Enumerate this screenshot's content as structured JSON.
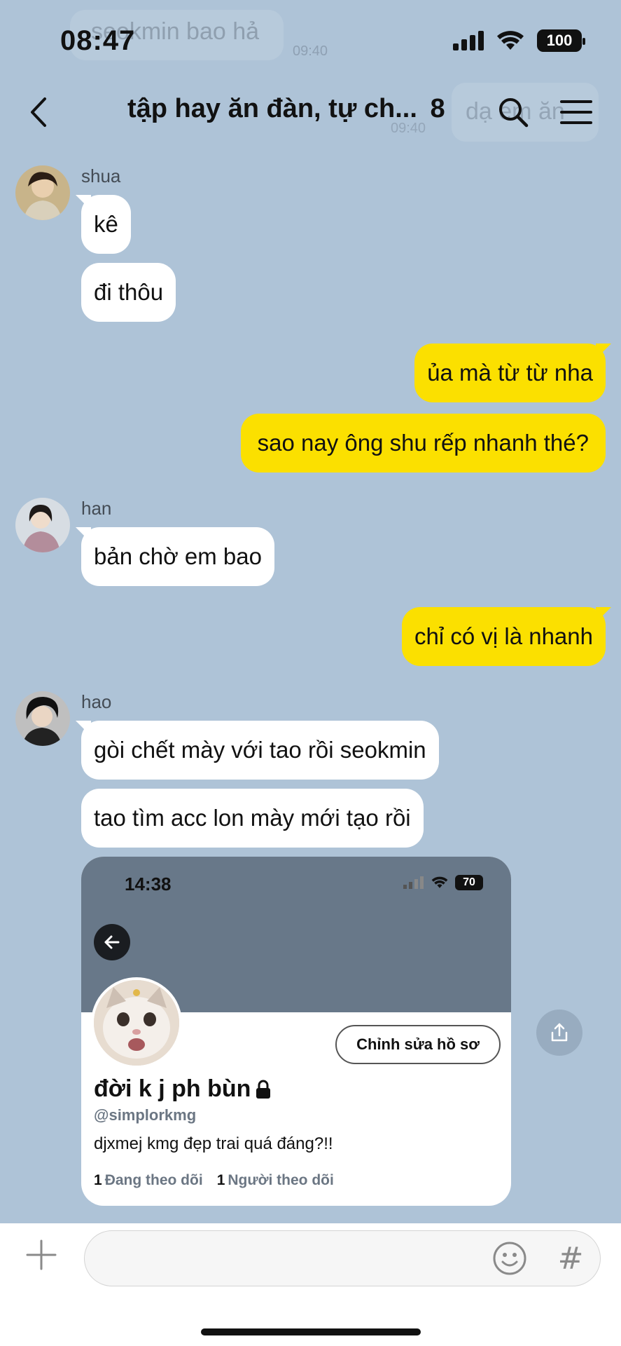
{
  "status_bar": {
    "time": "08:47",
    "battery": "100"
  },
  "background_ghost": {
    "message": "seokmin bao hả",
    "time": "09:40",
    "right_message": "dạ em ăn",
    "right_time": "09:40"
  },
  "header": {
    "title": "tập hay ăn đàn, tự ch...",
    "member_count": "8"
  },
  "messages": [
    {
      "sender": "shua",
      "bubbles": [
        "kê",
        "đi thôu"
      ]
    },
    {
      "outgoing": [
        "ủa mà từ từ nha",
        "sao nay ông shu rếp nhanh thé?"
      ]
    },
    {
      "sender": "han",
      "bubbles": [
        "bản chờ em bao"
      ]
    },
    {
      "outgoing": [
        "chỉ có vị là nhanh"
      ]
    },
    {
      "sender": "hao",
      "bubbles": [
        "gòi chết mày với tao rồi seokmin",
        "tao tìm acc lon mày mới tạo rồi"
      ]
    }
  ],
  "screenshot_card": {
    "time": "14:38",
    "battery": "70",
    "edit_button": "Chỉnh sửa hồ sơ",
    "name": "đời k j ph bùn",
    "handle": "@simplorkmg",
    "bio": "djxmej kmg đẹp trai quá đáng?!!",
    "following_count": "1",
    "following_label": "Đang theo dõi",
    "followers_count": "1",
    "followers_label": "Người theo dõi"
  },
  "colors": {
    "background": "#aec3d7",
    "outgoing_bubble": "#fbe000",
    "incoming_bubble": "#ffffff"
  },
  "icons": [
    "back-icon",
    "search-icon",
    "menu-icon",
    "share-icon",
    "plus-icon",
    "emoji-icon",
    "hash-icon",
    "lock-icon",
    "signal-icon",
    "wifi-icon"
  ]
}
